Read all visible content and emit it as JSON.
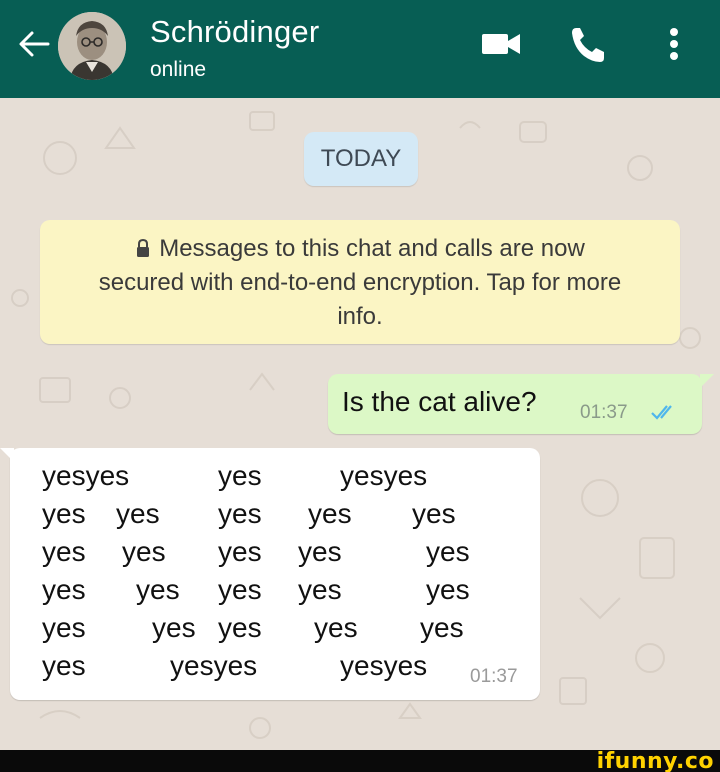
{
  "header": {
    "contact_name": "Schrödinger",
    "status": "online",
    "background": "#075e54",
    "icons": [
      "back-arrow-icon",
      "video-call-icon",
      "phone-icon",
      "more-vert-icon"
    ]
  },
  "chat": {
    "date_label": "TODAY",
    "encryption_notice": {
      "line1": "Messages to this chat and calls are now",
      "line2": "secured with end-to-end encryption. Tap for more",
      "line3": "info."
    },
    "messages": [
      {
        "direction": "outgoing",
        "text": "Is the cat alive?",
        "time": "01:37",
        "status": "read",
        "bubble_color": "#dcf8c6"
      },
      {
        "direction": "incoming",
        "lines": [
          [
            "yesyes",
            "yes",
            "yesyes"
          ],
          [
            "yes",
            "yes",
            "yes",
            "yes",
            "yes"
          ],
          [
            "yes",
            "yes",
            "yes",
            "yes",
            "yes"
          ],
          [
            "yes",
            "yes",
            "yes",
            "yes",
            "yes"
          ],
          [
            "yes",
            "yes",
            "yes",
            "yes",
            "yes"
          ],
          [
            "yes",
            "yesyes",
            "yesyes"
          ]
        ],
        "time": "01:37",
        "bubble_color": "#ffffff"
      }
    ]
  },
  "watermark": "ifunny.co"
}
